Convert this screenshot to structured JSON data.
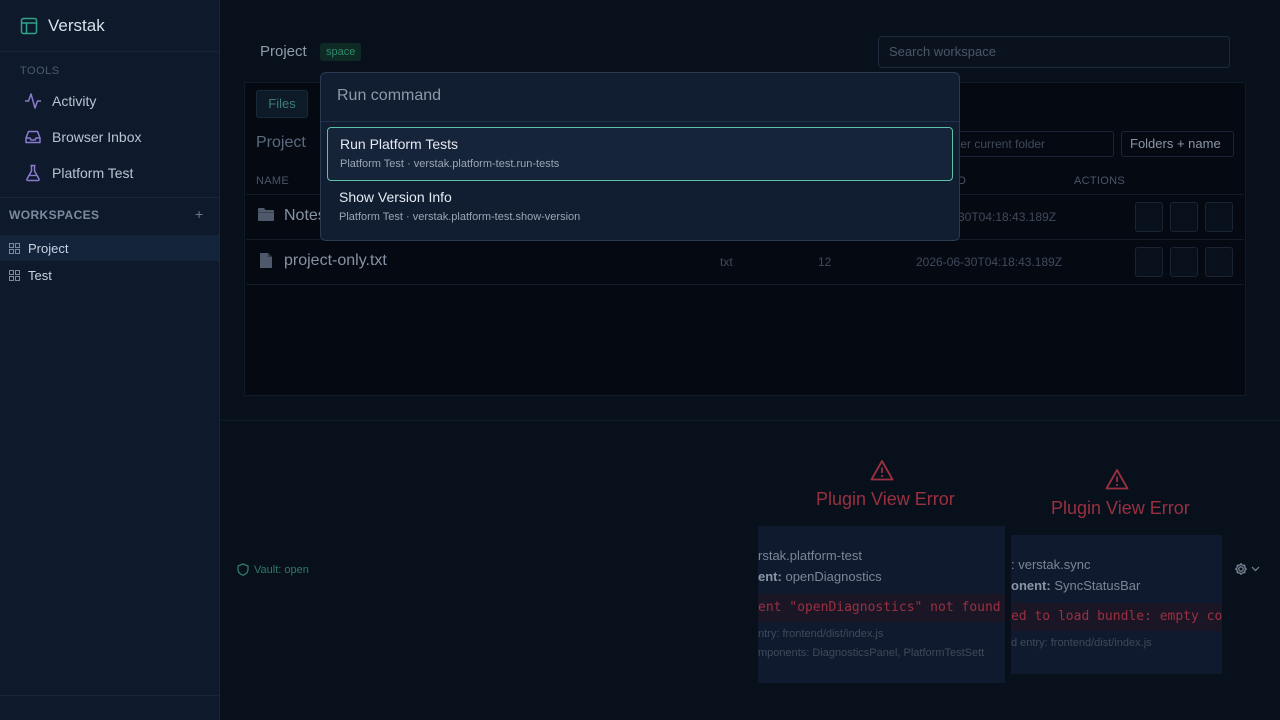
{
  "app": {
    "name": "Verstak"
  },
  "sidebar": {
    "tools_label": "TOOLS",
    "tools": [
      {
        "label": "Activity",
        "icon": "activity-icon"
      },
      {
        "label": "Browser Inbox",
        "icon": "inbox-icon"
      },
      {
        "label": "Platform Test",
        "icon": "flask-icon"
      }
    ],
    "workspaces_label": "WORKSPACES",
    "add_symbol": "+",
    "workspaces": [
      {
        "label": "Project",
        "active": true
      },
      {
        "label": "Test",
        "active": false
      }
    ]
  },
  "header": {
    "title": "Project",
    "badge": "space",
    "search_placeholder": "Search workspace"
  },
  "browser": {
    "tab": "Files",
    "breadcrumb": "Project",
    "filter_placeholder": "ter current folder",
    "mode_select": "Folders + name",
    "columns": {
      "name": "NAME",
      "modified": "D",
      "actions": "ACTIONS"
    },
    "rows": [
      {
        "name": "Notes",
        "type": "",
        "size": "",
        "modified": "30T04:18:43.189Z",
        "icon": "folder-icon"
      },
      {
        "name": "project-only.txt",
        "type": "txt",
        "size": "12",
        "modified": "2026-06-30T04:18:43.189Z",
        "icon": "file-icon"
      }
    ]
  },
  "status": {
    "vault": "Vault: open"
  },
  "errors": [
    {
      "title": "Plugin View Error",
      "plugin": "rstak.platform-test",
      "component_label": "ent:",
      "component_value": "openDiagnostics",
      "code": "ent \"openDiagnostics\" not found i",
      "entry": "ntry: frontend/dist/index.js",
      "components": "mponents: DiagnosticsPanel, PlatformTestSett"
    },
    {
      "title": "Plugin View Error",
      "plugin": ": verstak.sync",
      "component_label": "onent:",
      "component_value": "SyncStatusBar",
      "code": "ed to load bundle: empty cor",
      "entry": "d entry: frontend/dist/index.js"
    }
  ],
  "palette": {
    "placeholder": "Run command",
    "items": [
      {
        "title": "Run Platform Tests",
        "subtitle": "Platform Test · verstak.platform-test.run-tests",
        "selected": true
      },
      {
        "title": "Show Version Info",
        "subtitle": "Platform Test · verstak.platform-test.show-version",
        "selected": false
      }
    ]
  },
  "colors": {
    "accent": "#5fc0a8",
    "error": "#9a3040",
    "brand_icon": "#2fa38a"
  }
}
